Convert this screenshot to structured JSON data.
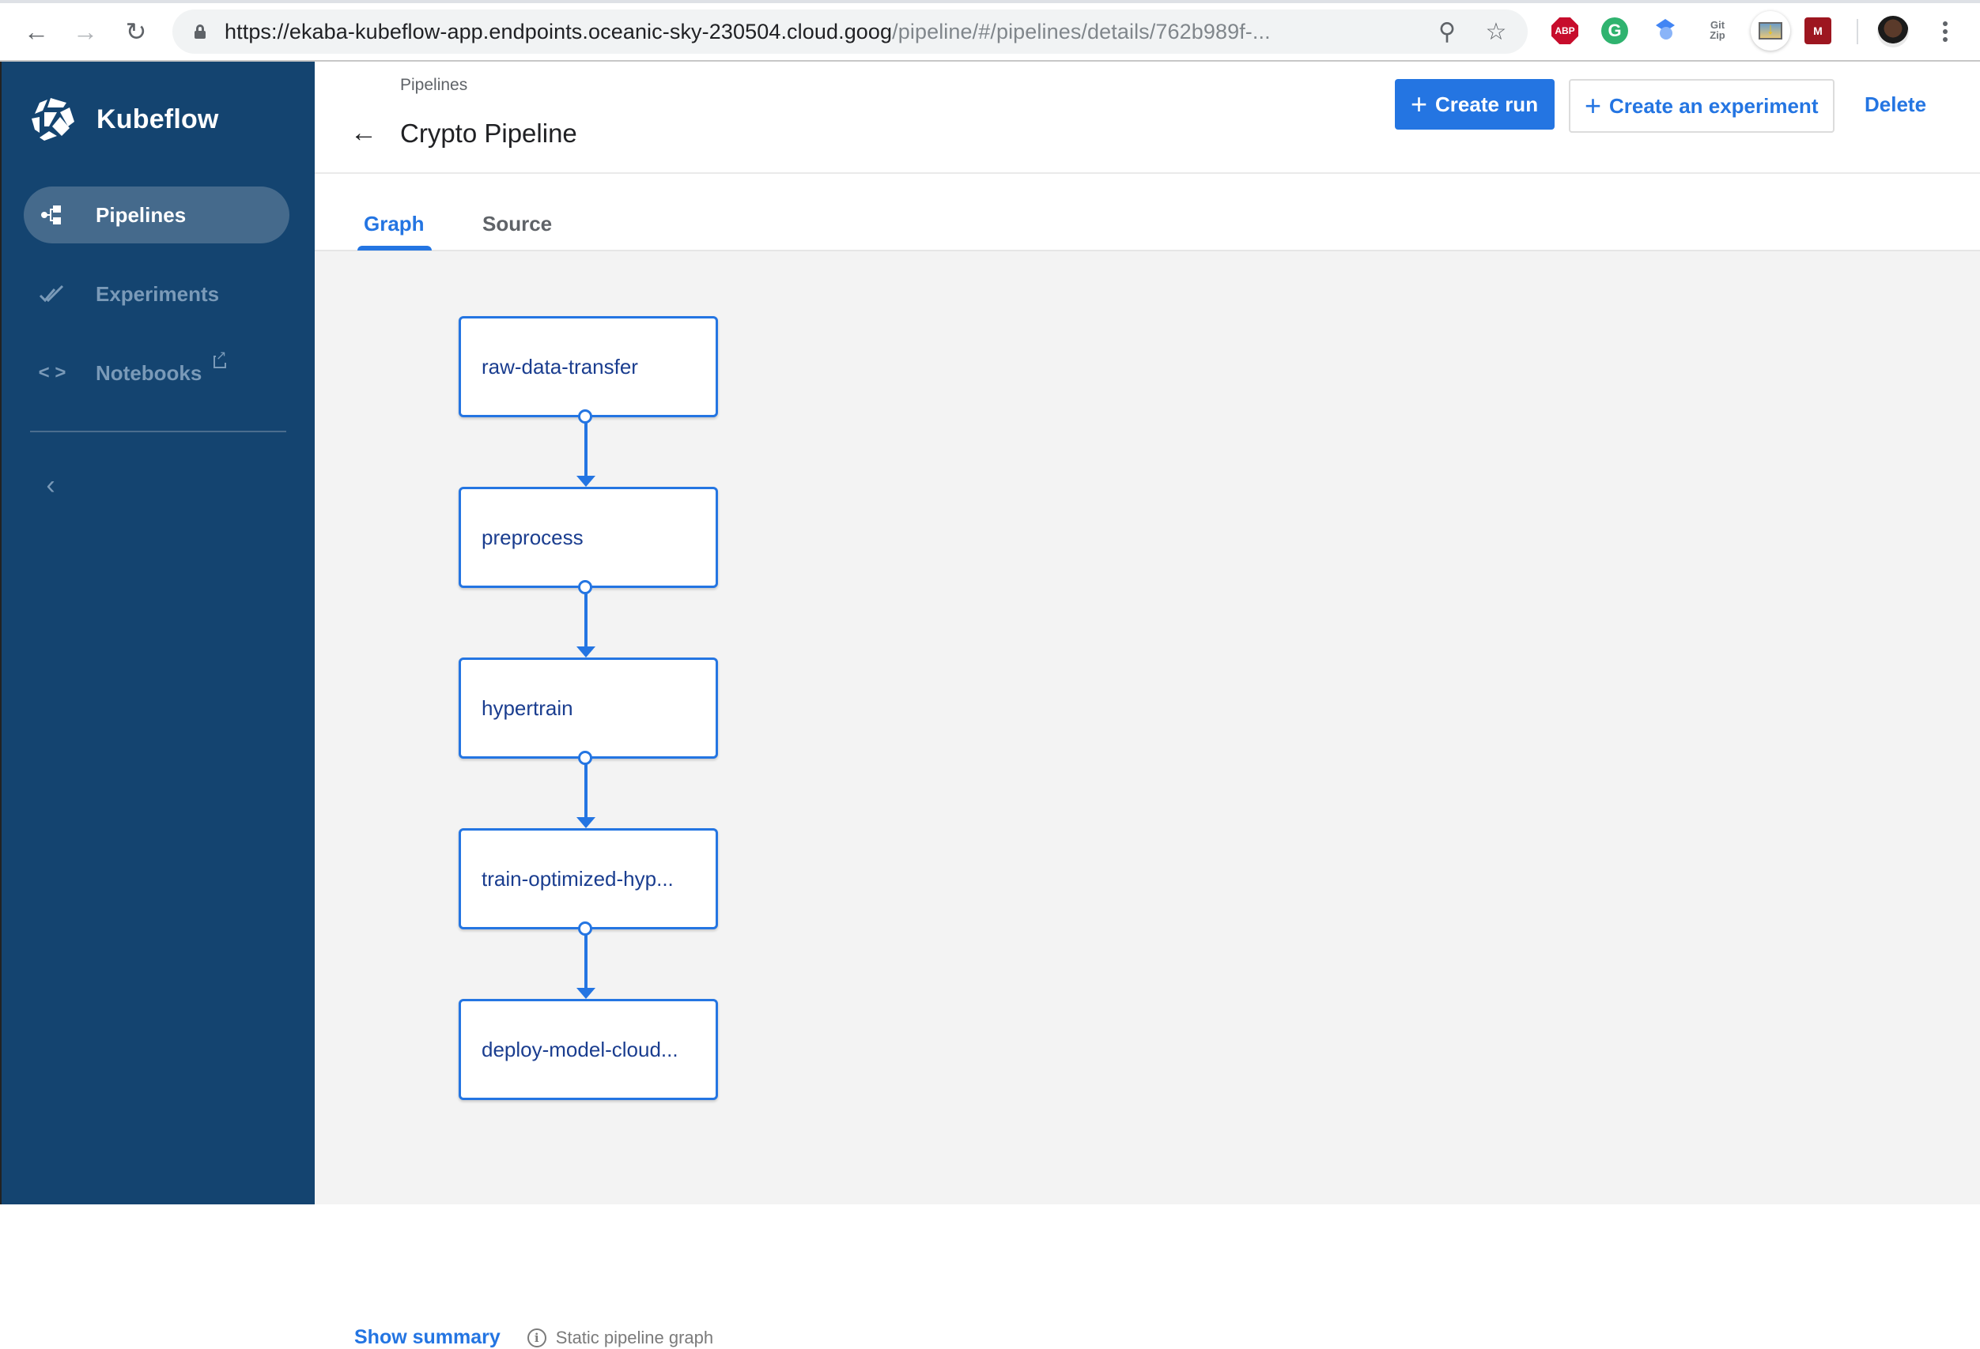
{
  "browser": {
    "url_host": "https://ekaba-kubeflow-app.endpoints.oceanic-sky-230504.cloud.goog",
    "url_rest": "/pipeline/#/pipelines/details/762b989f-...",
    "extensions": [
      {
        "name": "adblock-plus",
        "label": "ABP"
      },
      {
        "name": "grammarly",
        "label": "G"
      },
      {
        "name": "google-scholar",
        "label": ""
      },
      {
        "name": "gitzip",
        "label_top": "Git",
        "label_bottom": "Zip"
      },
      {
        "name": "image-downloader",
        "label": ""
      },
      {
        "name": "mendeley",
        "label": "M"
      }
    ]
  },
  "sidebar": {
    "brand": "Kubeflow",
    "items": [
      {
        "label": "Pipelines",
        "icon": "pipelines-icon",
        "active": true
      },
      {
        "label": "Experiments",
        "icon": "experiments-icon",
        "active": false
      },
      {
        "label": "Notebooks",
        "icon": "code-icon",
        "active": false,
        "external": true
      }
    ],
    "collapse_icon": "chevron-left-icon"
  },
  "header": {
    "breadcrumb": "Pipelines",
    "title": "Crypto Pipeline",
    "actions": {
      "create_run": "Create run",
      "create_experiment": "Create an experiment",
      "delete": "Delete"
    }
  },
  "tabs": [
    {
      "label": "Graph",
      "active": true
    },
    {
      "label": "Source",
      "active": false
    }
  ],
  "graph": {
    "nodes": [
      {
        "label": "raw-data-transfer"
      },
      {
        "label": "preprocess"
      },
      {
        "label": "hypertrain"
      },
      {
        "label": "train-optimized-hyp..."
      },
      {
        "label": "deploy-model-cloud..."
      }
    ],
    "edges": [
      {
        "from": "raw-data-transfer",
        "to": "preprocess"
      },
      {
        "from": "preprocess",
        "to": "hypertrain"
      },
      {
        "from": "hypertrain",
        "to": "train-optimized-hyp..."
      },
      {
        "from": "train-optimized-hyp...",
        "to": "deploy-model-cloud..."
      }
    ]
  },
  "footer": {
    "show_summary": "Show summary",
    "static_label": "Static pipeline graph"
  },
  "colors": {
    "sidebar_bg": "#144470",
    "accent": "#2475e2",
    "node_text": "#1a3d8f",
    "graph_bg": "#f3f3f3"
  }
}
